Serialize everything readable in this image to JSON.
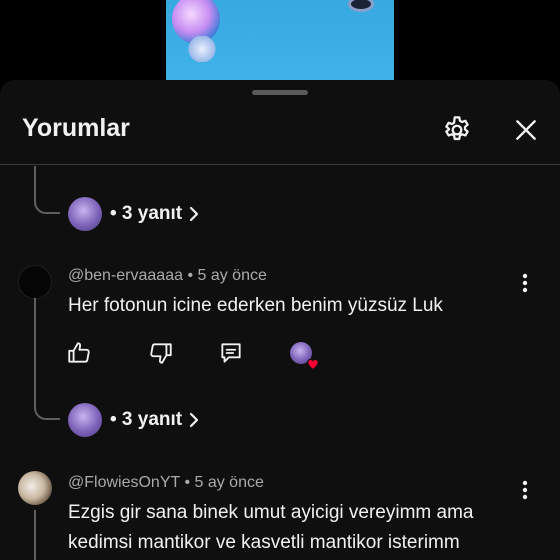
{
  "panel": {
    "title": "Yorumlar",
    "settings_icon": "gear-icon",
    "close_icon": "close-icon"
  },
  "threads": [
    {
      "reply_count_label": "• 3 yanıt"
    },
    {
      "reply_count_label": "• 3 yanıt"
    }
  ],
  "comments": [
    {
      "author": "@ben-ervaaaaa",
      "time": "• 5 ay önce",
      "text": "Her fotonun icine ederken benim yüzsüz Luk",
      "actions": [
        "like-icon",
        "dislike-icon",
        "reply-icon",
        "creator-heart"
      ]
    },
    {
      "author": "@FlowiesOnYT",
      "time": "• 5 ay önce",
      "text_line1": "Ezgis gir sana binek umut ayicigi vereyimm ama",
      "text_line2": "kedimsi mantikor ve kasvetli mantikor isterimm"
    }
  ],
  "colors": {
    "panel_bg": "#0f0f0f",
    "text": "#f1f1f1",
    "meta": "#aaaaaa",
    "heart": "#ff0033"
  }
}
